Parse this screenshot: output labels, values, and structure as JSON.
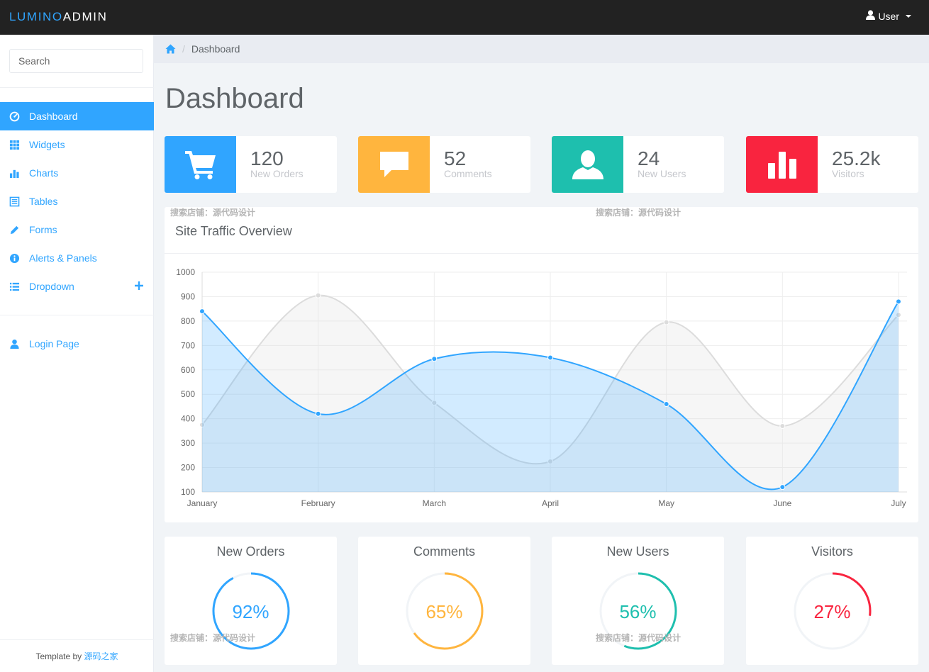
{
  "brand": {
    "part1": "LUMINO",
    "part2": "ADMIN"
  },
  "user_menu": {
    "label": "User"
  },
  "search": {
    "placeholder": "Search"
  },
  "sidebar": {
    "items": [
      {
        "label": "Dashboard",
        "icon": "dashboard-icon",
        "active": true
      },
      {
        "label": "Widgets",
        "icon": "grid-icon"
      },
      {
        "label": "Charts",
        "icon": "bar-chart-icon"
      },
      {
        "label": "Tables",
        "icon": "table-icon"
      },
      {
        "label": "Forms",
        "icon": "pencil-icon"
      },
      {
        "label": "Alerts & Panels",
        "icon": "info-icon"
      },
      {
        "label": "Dropdown",
        "icon": "list-icon"
      }
    ],
    "login": {
      "label": "Login Page",
      "icon": "user-icon"
    },
    "footer": {
      "prefix": "Template by ",
      "link": "源码之家"
    }
  },
  "breadcrumb": {
    "current": "Dashboard"
  },
  "page_title": "Dashboard",
  "stats": [
    {
      "value": "120",
      "label": "New Orders",
      "color": "#30a5ff",
      "icon": "shopping-cart-icon"
    },
    {
      "value": "52",
      "label": "Comments",
      "color": "#ffb53e",
      "icon": "comment-icon"
    },
    {
      "value": "24",
      "label": "New Users",
      "color": "#1ebfae",
      "icon": "user-icon"
    },
    {
      "value": "25.2k",
      "label": "Visitors",
      "color": "#f9243f",
      "icon": "bar-chart-icon"
    }
  ],
  "traffic_panel": {
    "title": "Site Traffic Overview"
  },
  "chart_data": {
    "type": "area",
    "categories": [
      "January",
      "February",
      "March",
      "April",
      "May",
      "June",
      "July"
    ],
    "series": [
      {
        "values": [
          375,
          905,
          465,
          225,
          795,
          370,
          825
        ],
        "color": "#dcdcdc"
      },
      {
        "values": [
          840,
          420,
          645,
          650,
          460,
          120,
          880
        ],
        "color": "#30a5ff"
      }
    ],
    "ylim": [
      100,
      1000
    ],
    "yticks": [
      100,
      200,
      300,
      400,
      500,
      600,
      700,
      800,
      900,
      1000
    ],
    "grid": true
  },
  "donuts": [
    {
      "title": "New Orders",
      "value": 92,
      "display": "92%",
      "color": "#30a5ff"
    },
    {
      "title": "Comments",
      "value": 65,
      "display": "65%",
      "color": "#ffb53e"
    },
    {
      "title": "New Users",
      "value": 56,
      "display": "56%",
      "color": "#1ebfae"
    },
    {
      "title": "Visitors",
      "value": 27,
      "display": "27%",
      "color": "#f9243f"
    }
  ],
  "watermark": {
    "text": "搜索店铺：源代码设计"
  }
}
